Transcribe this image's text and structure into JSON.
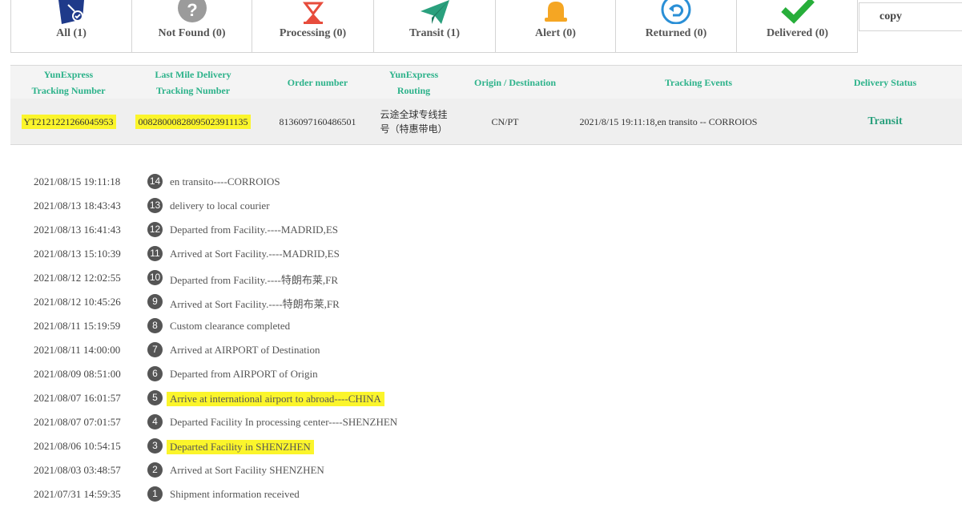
{
  "tabs": [
    {
      "label": "All (1)",
      "icon": "box-icon",
      "color": "#1f3a8a"
    },
    {
      "label": "Not Found (0)",
      "icon": "question-icon",
      "color": "#9b9b9b"
    },
    {
      "label": "Processing (0)",
      "icon": "hourglass-icon",
      "color": "#e74c3c"
    },
    {
      "label": "Transit (1)",
      "icon": "paper-plane-icon",
      "color": "#2aa07d"
    },
    {
      "label": "Alert (0)",
      "icon": "bell-icon",
      "color": "#f5a623"
    },
    {
      "label": "Returned (0)",
      "icon": "return-arrow-icon",
      "color": "#2a8fd6"
    },
    {
      "label": "Delivered (0)",
      "icon": "checkmark-icon",
      "color": "#27ae3a"
    }
  ],
  "copy_label": "copy",
  "table": {
    "headers": [
      [
        "YunExpress",
        "Tracking Number"
      ],
      [
        "Last Mile Delivery",
        "Tracking Number"
      ],
      [
        "Order number"
      ],
      [
        "YunExpress",
        "Routing"
      ],
      [
        "Origin / Destination"
      ],
      [
        "Tracking Events"
      ],
      [
        "Delivery Status"
      ]
    ],
    "row": {
      "tracking_number": "YT2121221266045953",
      "last_mile_number": "00828000828095023911135",
      "order_number": "8136097160486501",
      "routing_line1": "云途全球专线挂",
      "routing_line2": "号（特惠带电）",
      "origin_destination": "CN/PT",
      "tracking_event": "2021/8/15 19:11:18,en transito -- CORROIOS",
      "delivery_status": "Transit"
    }
  },
  "events": [
    {
      "time": "2021/08/15 19:11:18",
      "num": "14",
      "desc": "en transito----CORROIOS",
      "highlight": false
    },
    {
      "time": "2021/08/13 18:43:43",
      "num": "13",
      "desc": "delivery to local courier",
      "highlight": false
    },
    {
      "time": "2021/08/13 16:41:43",
      "num": "12",
      "desc": "Departed from Facility.----MADRID,ES",
      "highlight": false
    },
    {
      "time": "2021/08/13 15:10:39",
      "num": "11",
      "desc": "Arrived at Sort Facility.----MADRID,ES",
      "highlight": false
    },
    {
      "time": "2021/08/12 12:02:55",
      "num": "10",
      "desc": "Departed from Facility.----特朗布莱,FR",
      "highlight": false
    },
    {
      "time": "2021/08/12 10:45:26",
      "num": "9",
      "desc": "Arrived at Sort Facility.----特朗布莱,FR",
      "highlight": false
    },
    {
      "time": "2021/08/11 15:19:59",
      "num": "8",
      "desc": "Custom clearance completed",
      "highlight": false
    },
    {
      "time": "2021/08/11 14:00:00",
      "num": "7",
      "desc": "Arrived at AIRPORT of Destination",
      "highlight": false
    },
    {
      "time": "2021/08/09 08:51:00",
      "num": "6",
      "desc": "Departed from AIRPORT of Origin",
      "highlight": false
    },
    {
      "time": "2021/08/07 16:01:57",
      "num": "5",
      "desc": "Arrive at international airport to abroad----CHINA",
      "highlight": true
    },
    {
      "time": "2021/08/07 07:01:57",
      "num": "4",
      "desc": "Departed Facility In processing center----SHENZHEN",
      "highlight": false
    },
    {
      "time": "2021/08/06 10:54:15",
      "num": "3",
      "desc": "Departed Facility in SHENZHEN",
      "highlight": true
    },
    {
      "time": "2021/08/03 03:48:57",
      "num": "2",
      "desc": "Arrived at Sort Facility SHENZHEN",
      "highlight": false
    },
    {
      "time": "2021/07/31 14:59:35",
      "num": "1",
      "desc": "Shipment information received",
      "highlight": false
    }
  ]
}
